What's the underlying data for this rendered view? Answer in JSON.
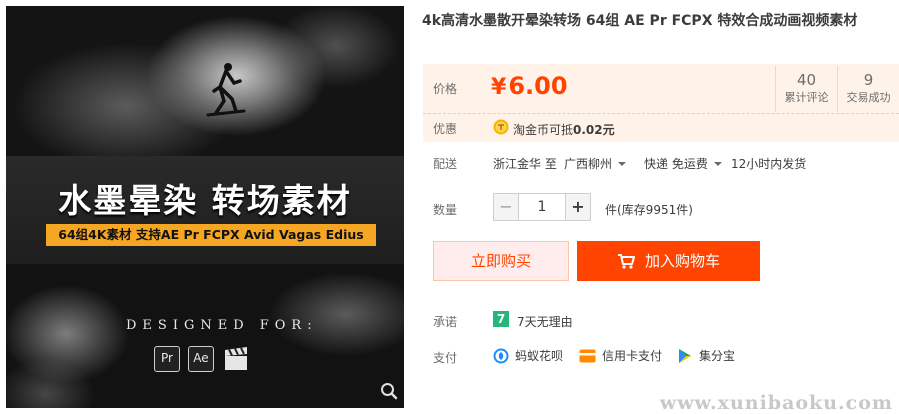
{
  "product": {
    "title": "4k高清水墨散开晕染转场 64组 AE Pr FCPX 特效合成动画视频素材",
    "image": {
      "title": "水墨晕染 转场素材",
      "subtitle": "64组4K素材 支持AE Pr FCPX Avid Vagas Edius",
      "designed_for": "DESIGNED FOR:",
      "app_icons": [
        "Pr",
        "Ae"
      ]
    }
  },
  "price": {
    "label": "价格",
    "currency": "¥",
    "value": "6.00",
    "stats": [
      {
        "num": "40",
        "label": "累计评论"
      },
      {
        "num": "9",
        "label": "交易成功"
      }
    ]
  },
  "discount": {
    "label": "优惠",
    "text_prefix": "淘金币可抵",
    "amount": "0.02元"
  },
  "shipping": {
    "label": "配送",
    "from": "浙江金华 至",
    "to": "广西柳州",
    "method": "快递 免运费",
    "eta": "12小时内发货"
  },
  "quantity": {
    "label": "数量",
    "value": "1",
    "minus": "−",
    "plus": "+",
    "stock": "件(库存9951件)"
  },
  "actions": {
    "buy_now": "立即购买",
    "add_cart": "加入购物车"
  },
  "promise": {
    "label": "承诺",
    "badge": "7",
    "text": "7天无理由"
  },
  "payment": {
    "label": "支付",
    "methods": [
      "蚂蚁花呗",
      "信用卡支付",
      "集分宝"
    ]
  },
  "watermark": "www.xunibaoku.com",
  "colors": {
    "accent": "#ff4400",
    "price_bg": "#fff2e8",
    "buy_now_bg": "#ffeded",
    "promise_green": "#26b67a"
  }
}
